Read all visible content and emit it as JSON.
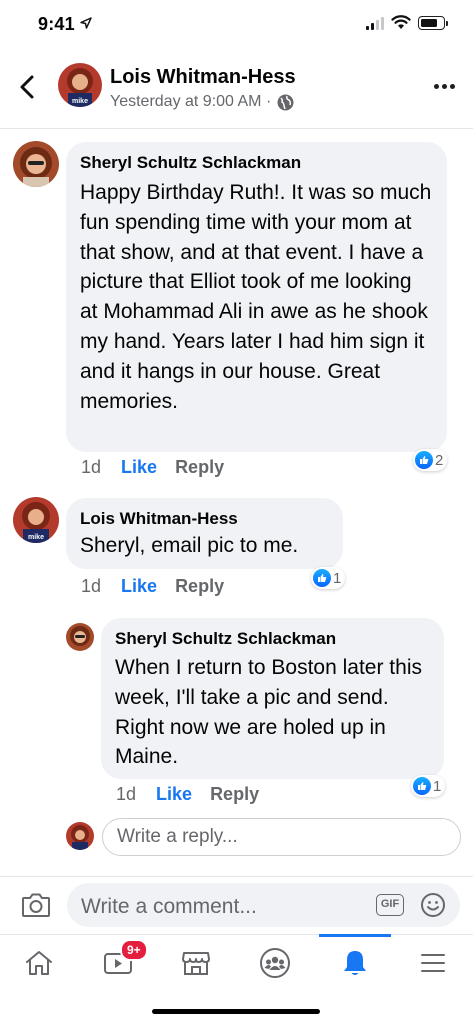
{
  "status_bar": {
    "time": "9:41"
  },
  "header": {
    "title": "Lois Whitman-Hess",
    "meta": "Yesterday at 9:00 AM ·",
    "avatar_badge": "mike"
  },
  "comments": [
    {
      "author": "Sheryl Schultz Schlackman",
      "text": "Happy Birthday Ruth!. It was so much fun spending time with your mom at that show, and at that event. I have a picture that Elliot took of me looking at Mohammad Ali in awe as he shook my hand.  Years later I had him sign it and it hangs in our house. Great memories.",
      "time": "1d",
      "like_label": "Like",
      "reply_label": "Reply",
      "reaction_count": "2"
    },
    {
      "author": "Lois Whitman-Hess",
      "text": "Sheryl, email pic to me.",
      "time": "1d",
      "like_label": "Like",
      "reply_label": "Reply",
      "reaction_count": "1"
    },
    {
      "author": "Sheryl Schultz Schlackman",
      "text": "When I return to Boston later this week, I'll take a pic and send. Right now we are holed up in Maine.",
      "time": "1d",
      "like_label": "Like",
      "reply_label": "Reply",
      "reaction_count": "1"
    }
  ],
  "reply_input": {
    "placeholder": "Write a reply..."
  },
  "composer": {
    "placeholder": "Write a comment...",
    "gif_label": "GIF"
  },
  "tabbar": {
    "video_badge": "9+",
    "tabs": [
      "home-icon",
      "video-icon",
      "marketplace-icon",
      "groups-icon",
      "notifications-icon",
      "menu-icon"
    ],
    "active": "notifications-icon"
  },
  "colors": {
    "accent": "#1877f2",
    "bubble": "#f0f2f5",
    "muted": "#65676b",
    "badge": "#e41e3f"
  }
}
